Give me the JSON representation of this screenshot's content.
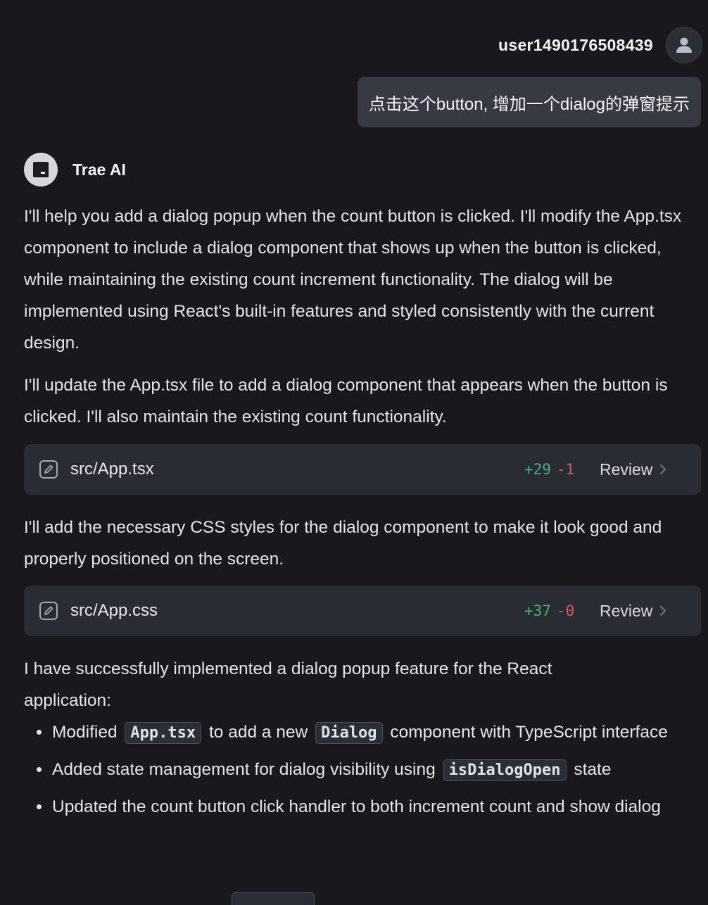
{
  "user": {
    "name": "user1490176508439",
    "avatar_icon": "person-icon",
    "message": "点击这个button, 增加一个dialog的弹窗提示"
  },
  "assistant": {
    "name": "Trae AI",
    "avatar_icon": "terminal-icon"
  },
  "content": {
    "p1": "I'll help you add a dialog popup when the count button is clicked. I'll modify the App.tsx component to include a dialog component that shows up when the button is clicked, while maintaining the existing count increment functionality. The dialog will be implemented using React's built-in features and styled consistently with the current design.",
    "p2": "I'll update the App.tsx file to add a dialog component that appears when the button is clicked. I'll also maintain the existing count functionality.",
    "p3": "I'll add the necessary CSS styles for the dialog component to make it look good and properly positioned on the screen.",
    "p4": "I have successfully implemented a dialog popup feature for the React application:"
  },
  "files": [
    {
      "name": "src/App.tsx",
      "additions": "+29",
      "deletions": "-1",
      "action": "Review"
    },
    {
      "name": "src/App.css",
      "additions": "+37",
      "deletions": "-0",
      "action": "Review"
    }
  ],
  "summary": {
    "item1_pre": "Modified",
    "item1_code1": "App.tsx",
    "item1_mid": "to add a new",
    "item1_code2": "Dialog",
    "item1_post": "component with TypeScript interface",
    "item2_pre": "Added state management for dialog visibility using",
    "item2_code": "isDialogOpen",
    "item2_post": "state",
    "item3": "Updated the count button click handler to both increment count and show dialog"
  },
  "colors": {
    "background": "#18191e",
    "card": "#2a2c33",
    "bubble": "#373a43",
    "additions": "#3bb37a",
    "deletions": "#e05555"
  }
}
